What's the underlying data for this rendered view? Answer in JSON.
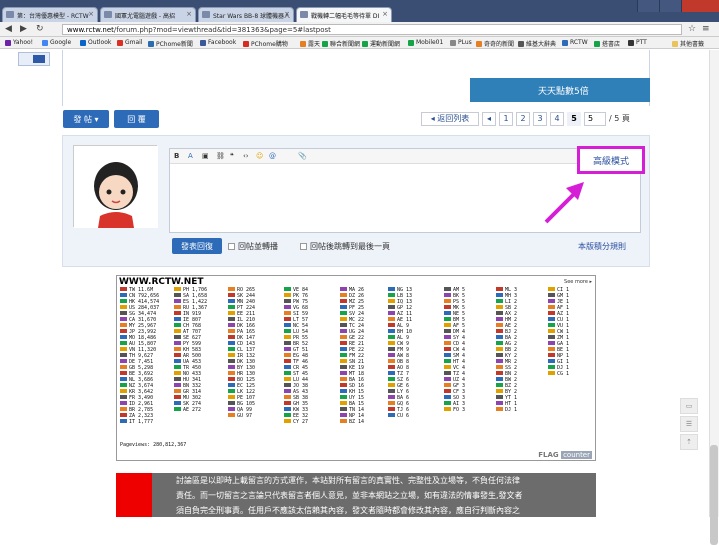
{
  "browser": {
    "tabs": [
      {
        "label": "第：台灣優惠模型 - RCTW"
      },
      {
        "label": "國軍尤電腦遊戲 - 高招"
      },
      {
        "label": "Star Wars BB-8 球體機器人"
      },
      {
        "label": "戰機轉二幅毛毛等待單 DI"
      }
    ],
    "url_host": "www.rctw.net",
    "url_path": "/forum.php?mod=viewthread&tid=381363&page=5#lastpost",
    "bookmarks": [
      "Yahoo!",
      "Google",
      "Outlook",
      "Gmail",
      "PChome新聞",
      "Facebook",
      "PChome購物",
      "露天",
      "聯合新聞網",
      "運動新聞網",
      "Mobile01",
      "PLus",
      "奇奇的新聞",
      "維基大辭典",
      "RCTW",
      "搭書店",
      "PTT",
      "其他書籤"
    ]
  },
  "page": {
    "promo_text": "天天點數5倍",
    "post_button": "發 帖 ▾",
    "reply_button": "回 覆",
    "pager": {
      "back_label": "◂ 返回列表",
      "prev": "◂",
      "pages": [
        "1",
        "2",
        "3",
        "4",
        "5"
      ],
      "current": "5",
      "jump_value": "5",
      "total": "/ 5 頁"
    },
    "editor": {
      "advanced_mode": "高級模式"
    },
    "submit_button": "發表回復",
    "check1": "回帖並轉播",
    "check2": "回帖後跳轉到最後一頁",
    "rules_link": "本版積分規則",
    "flag": {
      "title": "WWW.RCTW.NET",
      "see_more": "See more ▸",
      "pageviews": "Pageviews: 280,812,367",
      "counter_label": "FLAG",
      "counter_suffix": "counter",
      "columns": [
        [
          "TW 11.6M",
          "CN 792,656",
          "HK 414,574",
          "US 284,037",
          "SG 34,474",
          "CA 31,670",
          "MY 25,967",
          "JP 23,992",
          "MO 18,486",
          "AU 15,807",
          "VN 11,320",
          "TH 9,627",
          "DE 7,451",
          "GB 5,298",
          "BE 3,692",
          "NL 3,686",
          "NZ 3,674",
          "KR 3,642",
          "FR 3,490",
          "ID 2,961",
          "BR 2,785",
          "ZA 2,323",
          "IT 1,777"
        ],
        [
          "PH 1,706",
          "SA 1,658",
          "ES 1,422",
          "RU 1,367",
          "IN 919",
          "IE 807",
          "CH 768",
          "AT 707",
          "SE 627",
          "PY 599",
          "KH 583",
          "AR 500",
          "UA 453",
          "TR 450",
          "NO 433",
          "HU 341",
          "BN 332",
          "GR 314",
          "MU 302",
          "SK 274",
          "AE 272"
        ],
        [
          "RO 265",
          "SK 244",
          "MN 240",
          "PT 224",
          "EE 211",
          "IL 210",
          "DK 166",
          "PA 165",
          "DK 147",
          "CD 143",
          "CL 137",
          "IR 132",
          "DK 130",
          "BY 130",
          "HR 130",
          "BO 125",
          "EC 125",
          "LK 122",
          "PE 107",
          "BG 105",
          "QA 99",
          "GU 97"
        ],
        [
          "VE 84",
          "PK 76",
          "PW 75",
          "VG 68",
          "SI 59",
          "LT 57",
          "NC 54",
          "LU 54",
          "PR 55",
          "BR 52",
          "GT 51",
          "EG 48",
          "TF 46",
          "CR 45",
          "ST 45",
          "LU 44",
          "JO 38",
          "AS 43",
          "SB 38",
          "GH 35",
          "KW 33",
          "EE 32",
          "CY 27"
        ],
        [
          "MA 26",
          "DZ 26",
          "MZ 25",
          "PF 25",
          "SV 24",
          "MC 22",
          "TC 24",
          "UG 24",
          "GE 22",
          "RE 21",
          "PE 22",
          "FM 22",
          "SN 21",
          "KE 19",
          "MT 18",
          "BA 16",
          "SD 16",
          "KH 15",
          "UY 15",
          "BA 15",
          "TN 14",
          "NP 14",
          "BZ 14"
        ],
        [
          "NG 13",
          "LB 13",
          "IQ 13",
          "GP 12",
          "AZ 11",
          "AE 11",
          "AL 9",
          "BH 10",
          "AL 9",
          "CW 9",
          "FM 9",
          "AW 8",
          "OB 8",
          "AO 8",
          "TZ 7",
          "SZ 6",
          "GE 6",
          "LY 6",
          "BA 6",
          "GQ 6",
          "TJ 6",
          "CU 6"
        ],
        [
          "AM 5",
          "BK 5",
          "PS 5",
          "MK 5",
          "NE 5",
          "BM 5",
          "AF 5",
          "DM 4",
          "SY 4",
          "CD 4",
          "CW 4",
          "SM 4",
          "HT 4",
          "VC 4",
          "TZ 4",
          "UZ 4",
          "GF 3",
          "CF 3",
          "SO 3",
          "AI 3",
          "FO 3"
        ],
        [
          "ML 3",
          "MH 3",
          "LI 2",
          "SB 2",
          "AX 2",
          "HM 2",
          "AE 2",
          "BJ 2",
          "BA 2",
          "AG 2",
          "BB 2",
          "KY 2",
          "MR 2",
          "SS 2",
          "BN 2",
          "BW 2",
          "BZ 2",
          "BY 2",
          "YT 1",
          "HT 1",
          "DJ 1"
        ],
        [
          "CI 1",
          "GM 1",
          "JE 1",
          "AF 1",
          "AZ 1",
          "CU 1",
          "VU 1",
          "CW 1",
          "ZM 1",
          "GA 1",
          "BE 1",
          "NP 1",
          "GI 1",
          "DJ 1",
          "CG 1"
        ]
      ]
    },
    "disclaimer_lines": [
      "討論區是以即時上載留言的方式運作，本站對所有留言的真實性、完整性及立場等，不負任何法律",
      "責任。而一切留言之言論只代表留言者個人意見，並非本網站之立場，如有違法的情事發生,發文者",
      "須自負完全刑事責。任用戶不應該太信賴其內容，發文者隨時都會修改其內容，應自行判斷內容之"
    ],
    "colors": {
      "accent": "#2d6bb8",
      "highlight": "#d51ed6"
    }
  }
}
